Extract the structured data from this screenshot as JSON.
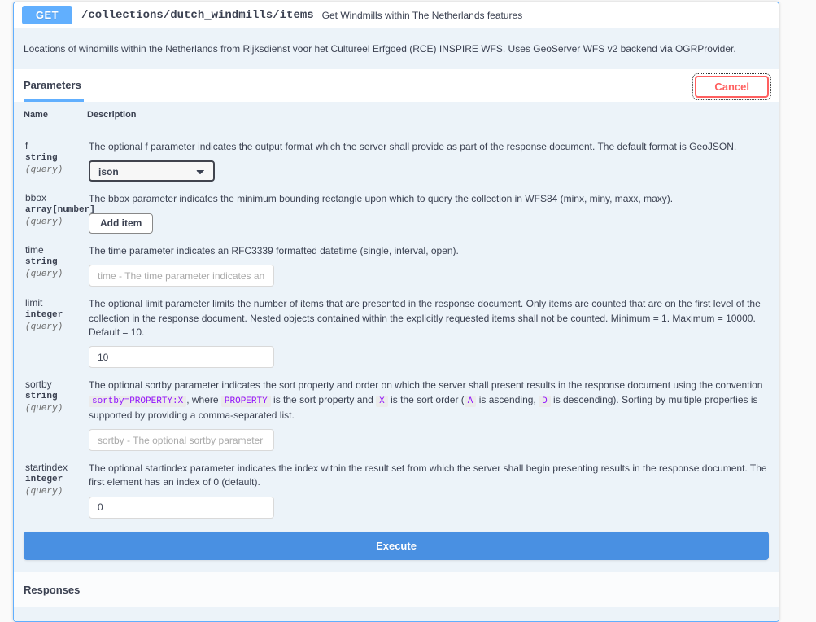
{
  "operation": {
    "method": "GET",
    "path": "/collections/dutch_windmills/items",
    "summary": "Get Windmills within The Netherlands features",
    "description": "Locations of windmills within the Netherlands from Rijksdienst voor het Cultureel Erfgoed (RCE) INSPIRE WFS. Uses GeoServer WFS v2 backend via OGRProvider."
  },
  "tabs": {
    "parameters_label": "Parameters",
    "cancel_label": "Cancel"
  },
  "table": {
    "header_name": "Name",
    "header_description": "Description"
  },
  "parameters": [
    {
      "name": "f",
      "type": "string",
      "in": "(query)",
      "description": "The optional f parameter indicates the output format which the server shall provide as part of the response document. The default format is GeoJSON.",
      "control": "select",
      "value": "json",
      "options": [
        "json"
      ]
    },
    {
      "name": "bbox",
      "type": "array[number]",
      "in": "(query)",
      "description": "The bbox parameter indicates the minimum bounding rectangle upon which to query the collection in WFS84 (minx, miny, maxx, maxy).",
      "control": "add-item",
      "add_item_label": "Add item"
    },
    {
      "name": "time",
      "type": "string",
      "in": "(query)",
      "description": "The time parameter indicates an RFC3339 formatted datetime (single, interval, open).",
      "control": "input",
      "value": "",
      "placeholder": "time - The time parameter indicates an"
    },
    {
      "name": "limit",
      "type": "integer",
      "in": "(query)",
      "description": "The optional limit parameter limits the number of items that are presented in the response document. Only items are counted that are on the first level of the collection in the response document. Nested objects contained within the explicitly requested items shall not be counted. Minimum = 1. Maximum = 10000. Default = 10.",
      "control": "input",
      "value": "10",
      "placeholder": ""
    },
    {
      "name": "sortby",
      "type": "string",
      "in": "(query)",
      "description_parts": [
        {
          "kind": "text",
          "text": "The optional sortby parameter indicates the sort property and order on which the server shall present results in the response document using the convention "
        },
        {
          "kind": "code",
          "text": "sortby=PROPERTY:X"
        },
        {
          "kind": "text",
          "text": ", where "
        },
        {
          "kind": "code",
          "text": "PROPERTY"
        },
        {
          "kind": "text",
          "text": " is the sort property and "
        },
        {
          "kind": "code",
          "text": "X"
        },
        {
          "kind": "text",
          "text": " is the sort order ("
        },
        {
          "kind": "code",
          "text": "A"
        },
        {
          "kind": "text",
          "text": " is ascending, "
        },
        {
          "kind": "code",
          "text": "D"
        },
        {
          "kind": "text",
          "text": " is descending). Sorting by multiple properties is supported by providing a comma-separated list."
        }
      ],
      "control": "input",
      "value": "",
      "placeholder": "sortby - The optional sortby parameter"
    },
    {
      "name": "startindex",
      "type": "integer",
      "in": "(query)",
      "description": "The optional startindex parameter indicates the index within the result set from which the server shall begin presenting results in the response document. The first element has an index of 0 (default).",
      "control": "input",
      "value": "0",
      "placeholder": ""
    }
  ],
  "execute": {
    "label": "Execute"
  },
  "responses": {
    "title": "Responses"
  },
  "colors": {
    "get_method": "#61affe",
    "execute_button": "#4990e2",
    "cancel": "#ff6060",
    "code_text": "#9012fe",
    "body_bg": "#ecf3f9"
  }
}
